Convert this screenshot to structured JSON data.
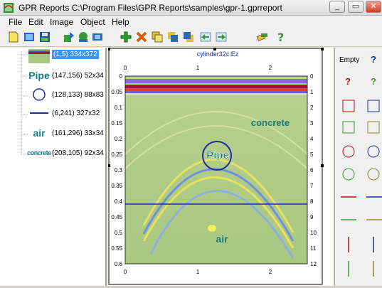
{
  "window": {
    "title": "GPR Reports C:\\Program Files\\GPR Reports\\samples\\gpr-1.gprreport"
  },
  "menu": {
    "items": [
      "File",
      "Edit",
      "Image",
      "Object",
      "Help"
    ]
  },
  "toolbar": {
    "icons": [
      "new-icon",
      "open-icon",
      "save-icon",
      "import-icon",
      "export-icon",
      "print-icon",
      "add-icon",
      "delete-icon",
      "copy-icon",
      "bring-front-icon",
      "send-back-icon",
      "undo-icon",
      "redo-icon",
      "link-icon",
      "help-icon"
    ]
  },
  "objects": [
    {
      "label": "(1,5) 334x372",
      "selected": true
    },
    {
      "label": "(147,156) 52x34",
      "thumb": "Pipe"
    },
    {
      "label": "(128,133) 88x83"
    },
    {
      "label": "(6,241) 327x32"
    },
    {
      "label": "(161,296) 33x34",
      "thumb": "air"
    },
    {
      "label": "(208,105) 92x34",
      "thumb": "concrete"
    }
  ],
  "plot": {
    "title": "cylinder32c:Ez",
    "x_ticks": [
      "0",
      "1",
      "2"
    ],
    "y_left_ticks": [
      "0",
      "0.05",
      "0.1",
      "0.15",
      "0.2",
      "0.25",
      "0.3",
      "0.35",
      "0.4",
      "0.45",
      "0.5",
      "0.55",
      "0.6"
    ],
    "y_right_ticks": [
      "0",
      "1",
      "2",
      "3",
      "4",
      "5",
      "6",
      "7",
      "8",
      "9",
      "10",
      "11",
      "12"
    ],
    "label_concrete": "concrete",
    "label_pipe": "Pipe",
    "label_air": "air"
  },
  "palette": {
    "empty_label": "Empty",
    "help_symbol": "?"
  },
  "colors": {
    "accent": "#3399ff",
    "label_teal": "#1a7a80",
    "circle": "#1e2d9a",
    "band_red": "#b0102a"
  }
}
